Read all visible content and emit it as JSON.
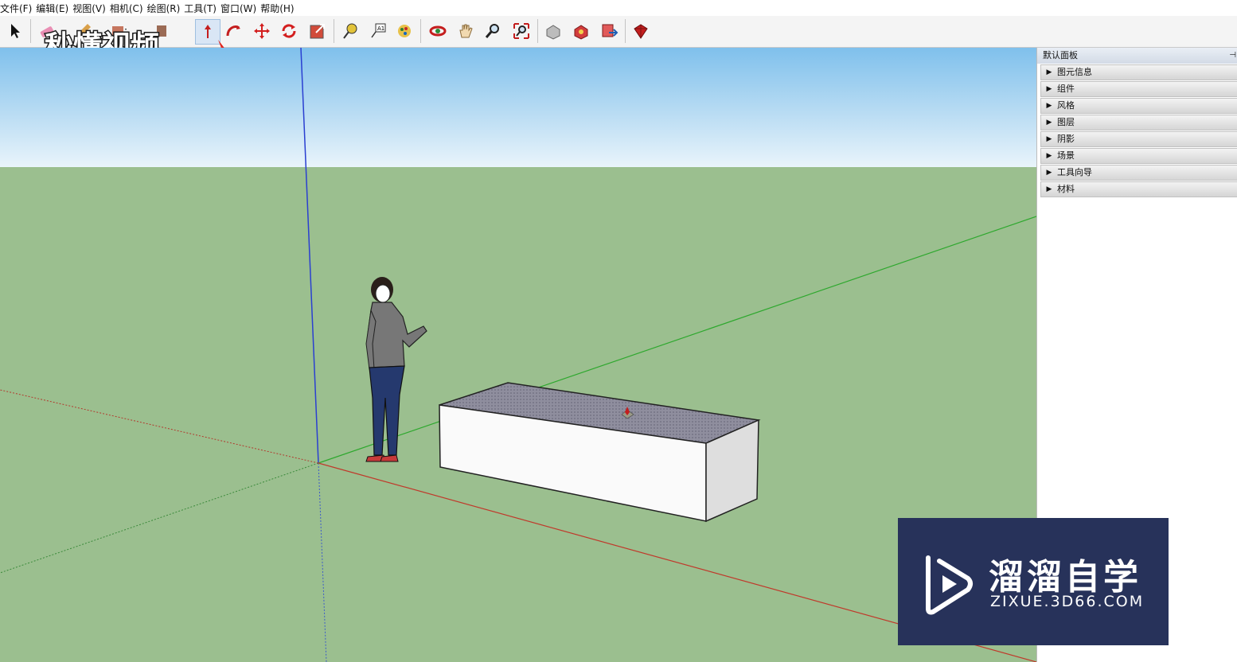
{
  "menu": {
    "items": [
      "文件(F)",
      "编辑(E)",
      "视图(V)",
      "相机(C)",
      "绘图(R)",
      "工具(T)",
      "窗口(W)",
      "帮助(H)"
    ]
  },
  "toolbar": {
    "tools": [
      "select-icon",
      "eraser-icon",
      "pencil-icon",
      "rectangle-icon",
      "paint-bucket-icon",
      "push-pull-icon",
      "follow-me-icon",
      "move-icon",
      "rotate-icon",
      "scale-icon",
      "tape-measure-icon",
      "text-icon",
      "paint-icon",
      "orbit-icon",
      "pan-icon",
      "zoom-icon",
      "zoom-extents-icon",
      "warehouse-icon",
      "components-icon",
      "share-model-icon",
      "extension-warehouse-icon"
    ]
  },
  "logo_top": {
    "text": "秒懂视频"
  },
  "panel": {
    "title": "默认面板",
    "trays": [
      "图元信息",
      "组件",
      "风格",
      "图层",
      "阴影",
      "场景",
      "工具向导",
      "材料"
    ]
  },
  "watermark": {
    "title": "溜溜自学",
    "url": "ZIXUE.3D66.COM"
  },
  "colors": {
    "sky_top": "#7fc0ec",
    "ground": "#9bbf8f",
    "axis_red": "#c0392b",
    "axis_green": "#2ea82e",
    "axis_blue": "#2a3fd1",
    "watermark_bg": "#27325a"
  }
}
